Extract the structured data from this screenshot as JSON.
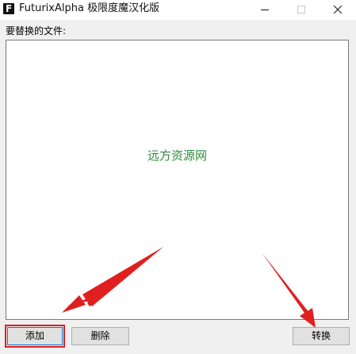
{
  "window": {
    "title": "FuturixAlpha 极限度魔汉化版",
    "app_icon_letter": "F"
  },
  "main": {
    "caption": "要替换的文件:",
    "watermark": "远方资源网",
    "file_list": []
  },
  "buttons": {
    "add_label": "添加",
    "delete_label": "删除",
    "convert_label": "转换"
  },
  "colors": {
    "annotation_red": "#e02020",
    "watermark_green": "#2e8b3a"
  }
}
